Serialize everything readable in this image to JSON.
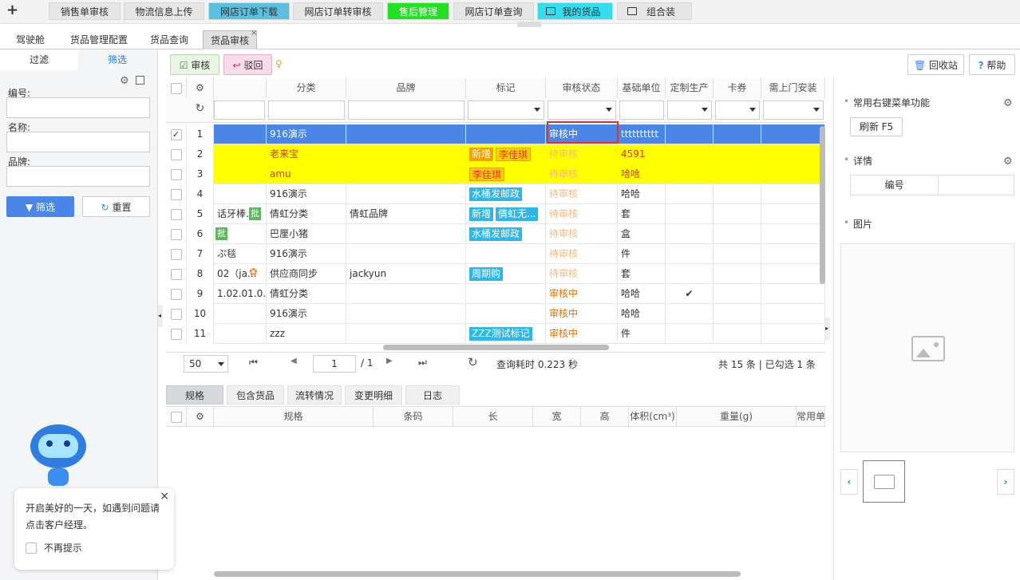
{
  "topbar": {
    "tabs": [
      {
        "label": "销售单审核",
        "bg": "#e6e6e6"
      },
      {
        "label": "物流信息上传",
        "bg": "#e6e6e6"
      },
      {
        "label": "网店订单下载",
        "bg": "#5bc0de"
      },
      {
        "label": "网店订单转审核",
        "bg": "#e6e6e6"
      },
      {
        "label": "售后管理",
        "bg": "#33dd33"
      },
      {
        "label": "网店订单查询",
        "bg": "#e6e6e6"
      },
      {
        "label": "我的货品",
        "bg": "#33ddee"
      },
      {
        "label": "组合装",
        "bg": "#e6e6e6"
      }
    ]
  },
  "subtabs": [
    "驾驶舱",
    "货品管理配置",
    "货品查询",
    "货品审核"
  ],
  "left": {
    "tab_filter": "过滤",
    "tab_screen": "筛选",
    "label_no": "编号:",
    "label_name": "名称:",
    "label_brand": "品牌:",
    "btn_screen": "筛选",
    "btn_reset": "重置",
    "bubble_text": "开启美好的一天，如遇到问题请点击客户经理。",
    "bubble_check": "不再提示"
  },
  "toolbar": {
    "audit": "审核",
    "reject": "驳回",
    "recycle": "回收站",
    "help": "帮助"
  },
  "grid": {
    "headers": [
      "分类",
      "品牌",
      "标记",
      "审核状态",
      "基础单位",
      "定制生产",
      "卡券",
      "需上门安装"
    ],
    "rows": [
      {
        "n": "1",
        "code": "",
        "cat": "916演示",
        "brand": "",
        "tags": [],
        "status": "审核中",
        "unit": "tttttttttt",
        "custom": "",
        "hl": "sel"
      },
      {
        "n": "2",
        "code": "",
        "cat": "老来宝",
        "brand": "",
        "tags": [
          {
            "t": "新增",
            "c": "y"
          },
          {
            "t": "李佳琪",
            "c": "r"
          }
        ],
        "status": "待审核",
        "unit": "4591",
        "custom": "",
        "hl": "yel"
      },
      {
        "n": "3",
        "code": "",
        "cat": "amu",
        "brand": "",
        "tags": [
          {
            "t": "李佳琪",
            "c": "r"
          }
        ],
        "status": "待审核",
        "unit": "哈哈",
        "custom": "",
        "hl": "yel"
      },
      {
        "n": "4",
        "code": "",
        "cat": "916演示",
        "brand": "",
        "tags": [
          {
            "t": "水桶发邮政",
            "c": "b"
          }
        ],
        "status": "待审核",
        "unit": "哈哈",
        "custom": "",
        "hl": ""
      },
      {
        "n": "5",
        "code": "话牙棒...",
        "cat": "倩虹分类",
        "brand": "倩虹品牌",
        "tags": [
          {
            "t": "新增",
            "c": "b"
          },
          {
            "t": "倩虹无...",
            "c": "b"
          }
        ],
        "status": "待审核",
        "unit": "套",
        "custom": "",
        "hl": ""
      },
      {
        "n": "6",
        "code": "",
        "cat": "巴厘小猪",
        "brand": "",
        "tags": [
          {
            "t": "水桶发邮政",
            "c": "b"
          }
        ],
        "status": "待审核",
        "unit": "盒",
        "custom": "",
        "hl": ""
      },
      {
        "n": "7",
        "code": "ぶ毯",
        "cat": "916演示",
        "brand": "",
        "tags": [],
        "status": "待审核",
        "unit": "件",
        "custom": "",
        "hl": ""
      },
      {
        "n": "8",
        "code": "02（ja...",
        "cat": "供应商同步",
        "brand": "jackyun",
        "tags": [
          {
            "t": "周期购",
            "c": "b"
          }
        ],
        "status": "待审核",
        "unit": "套",
        "custom": "",
        "hl": ""
      },
      {
        "n": "9",
        "code": "1.02.01.0...",
        "cat": "倩虹分类",
        "brand": "",
        "tags": [],
        "status": "审核中",
        "unit": "哈哈",
        "custom": "✔",
        "hl": ""
      },
      {
        "n": "10",
        "code": "",
        "cat": "916演示",
        "brand": "",
        "tags": [],
        "status": "审核中",
        "unit": "哈哈",
        "custom": "",
        "hl": ""
      },
      {
        "n": "11",
        "code": "",
        "cat": "zzz",
        "brand": "",
        "tags": [
          {
            "t": "ZZZ测试标记",
            "c": "b"
          }
        ],
        "status": "审核中",
        "unit": "件",
        "custom": "",
        "hl": ""
      }
    ]
  },
  "pager": {
    "size": "50",
    "page": "1",
    "total_pages": "/ 1",
    "time": "查询耗时 0.223 秒",
    "summary": "共 15 条 | 已勾选 1 条"
  },
  "bottom": {
    "tabs": [
      "规格",
      "包含货品",
      "流转情况",
      "变更明细",
      "日志"
    ],
    "headers": [
      "规格",
      "条码",
      "长",
      "宽",
      "高",
      "体积(cm³)",
      "重量(g)",
      "常用单"
    ]
  },
  "right": {
    "menu_title": "常用右键菜单功能",
    "refresh": "刷新 F5",
    "detail_title": "详情",
    "detail_col": "编号",
    "image_title": "图片"
  }
}
